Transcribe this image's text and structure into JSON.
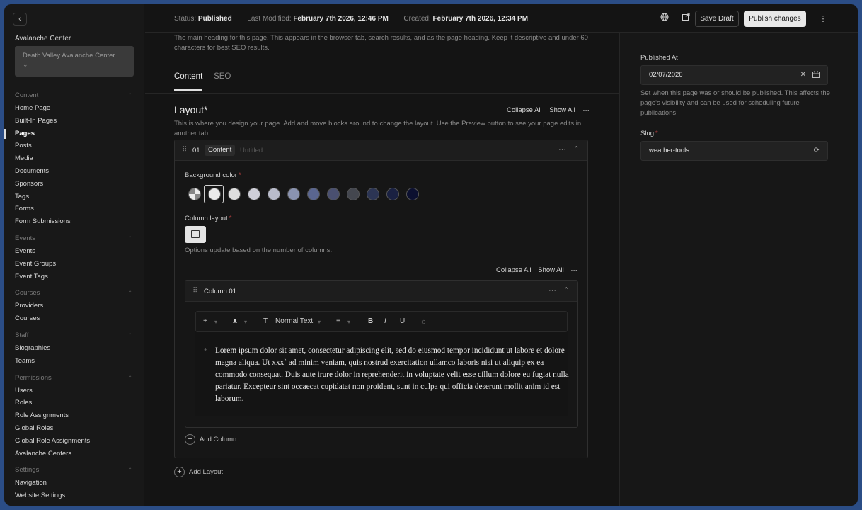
{
  "sidebar": {
    "tenant_label": "Avalanche Center",
    "tenant_value": "Death Valley Avalanche Center",
    "groups": [
      {
        "label": "Content",
        "items": [
          "Home Page",
          "Built-In Pages",
          "Pages",
          "Posts",
          "Media",
          "Documents",
          "Sponsors",
          "Tags",
          "Forms",
          "Form Submissions"
        ]
      },
      {
        "label": "Events",
        "items": [
          "Events",
          "Event Groups",
          "Event Tags"
        ]
      },
      {
        "label": "Courses",
        "items": [
          "Providers",
          "Courses"
        ]
      },
      {
        "label": "Staff",
        "items": [
          "Biographies",
          "Teams"
        ]
      },
      {
        "label": "Permissions",
        "items": [
          "Users",
          "Roles",
          "Role Assignments",
          "Global Roles",
          "Global Role Assignments",
          "Avalanche Centers"
        ]
      },
      {
        "label": "Settings",
        "items": [
          "Navigation",
          "Website Settings"
        ]
      }
    ],
    "active_item": "Pages"
  },
  "topbar": {
    "status_label": "Status:",
    "status_value": "Published",
    "modified_label": "Last Modified:",
    "modified_value": "February 7th 2026, 12:46 PM",
    "created_label": "Created:",
    "created_value": "February 7th 2026, 12:34 PM",
    "save_draft": "Save Draft",
    "publish": "Publish changes"
  },
  "main": {
    "helper_top": "The main heading for this page. This appears in the browser tab, search results, and as the page heading. Keep it descriptive and under 60 characters for best SEO results.",
    "tabs": [
      {
        "label": "Content",
        "active": true
      },
      {
        "label": "SEO",
        "active": false
      }
    ],
    "layout_title": "Layout*",
    "collapse_all": "Collapse All",
    "show_all": "Show All",
    "layout_desc": "This is where you design your page. Add and move blocks around to change the layout. Use the Preview button to see your page edits in another tab.",
    "block": {
      "number": "01",
      "type": "Content",
      "untitled": "Untitled",
      "bg_label": "Background color",
      "swatch_colors": [
        "#d9d9d9",
        "#ececec",
        "#dedede",
        "#cfcfd8",
        "#b9bccb",
        "#8a93b0",
        "#5a6690",
        "#4a5070",
        "#44474f",
        "#2c3554",
        "#1a2142",
        "#0c1030"
      ],
      "column_layout_label": "Column layout",
      "options_hint": "Options update based on the number of columns.",
      "column": {
        "title": "Column 01",
        "text_style": "Normal Text",
        "body": "Lorem ipsum dolor sit amet, consectetur adipiscing elit, sed do eiusmod tempor incididunt ut labore et dolore magna aliqua. Ut xxx` ad minim veniam, quis nostrud exercitation ullamco laboris nisi ut aliquip ex ea commodo consequat. Duis aute irure dolor in reprehenderit in voluptate velit esse cillum dolore eu fugiat nulla pariatur. Excepteur sint occaecat cupidatat non proident, sunt in culpa qui officia deserunt mollit anim id est laborum."
      },
      "add_column": "Add Column"
    },
    "add_layout": "Add Layout"
  },
  "right": {
    "published_at_label": "Published At",
    "published_at_value": "02/07/2026",
    "published_help": "Set when this page was or should be published. This affects the page's visibility and can be used for scheduling future publications.",
    "slug_label": "Slug",
    "slug_value": "weather-tools"
  }
}
